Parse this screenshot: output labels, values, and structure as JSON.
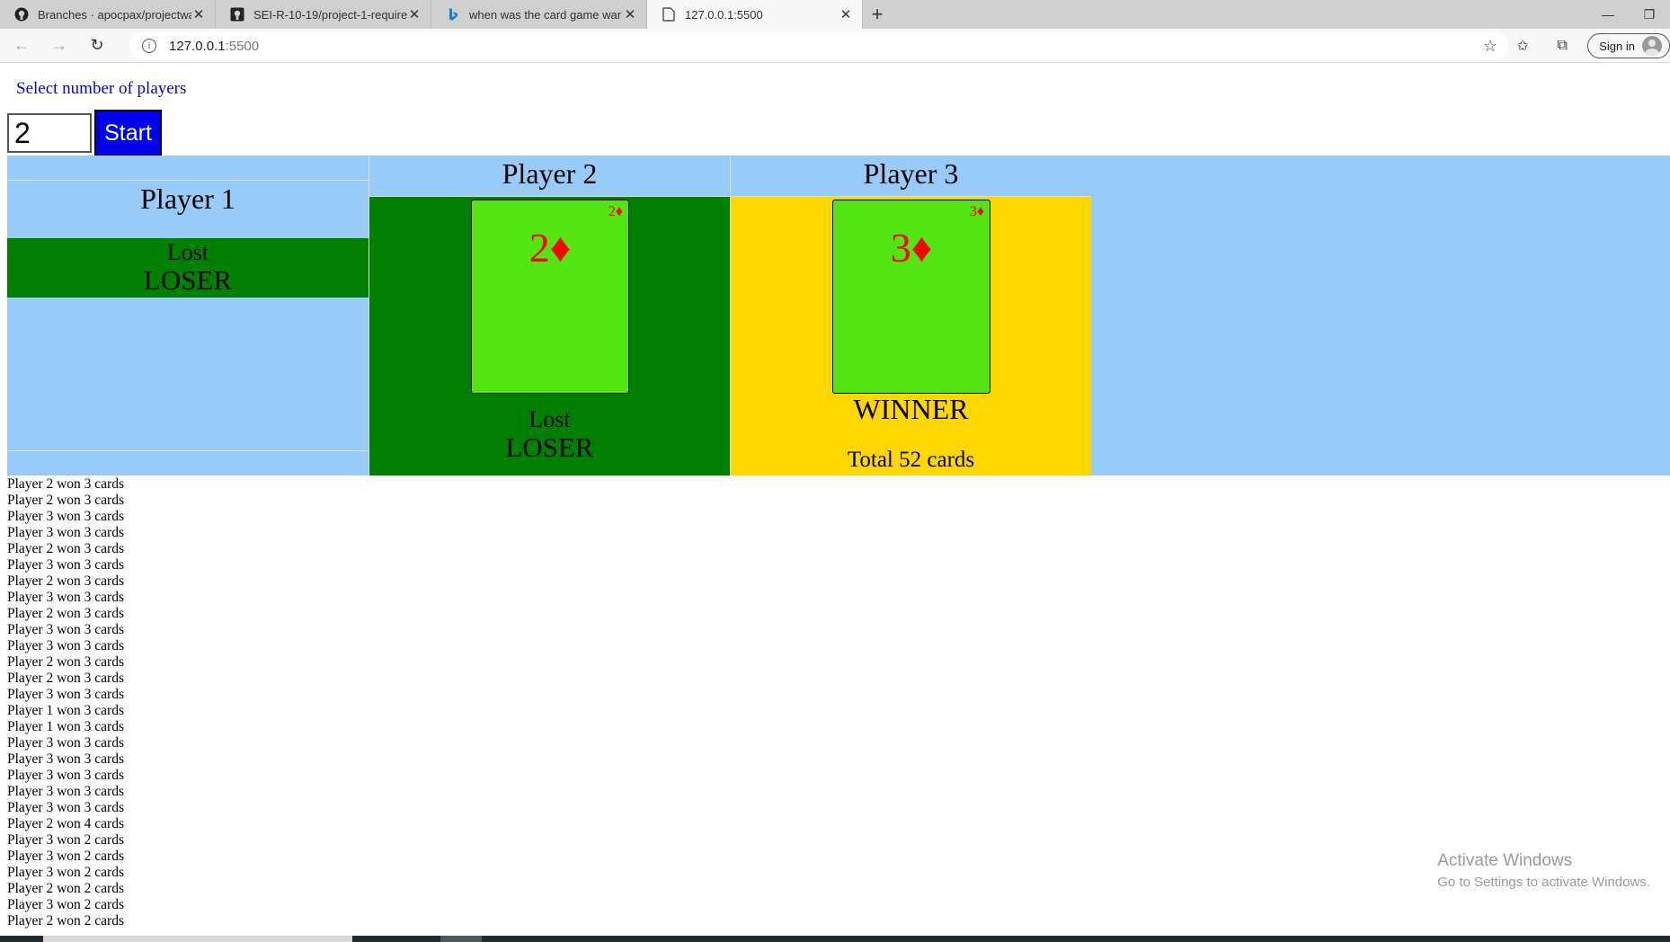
{
  "browser": {
    "tabs": [
      {
        "title": "Branches · apocpax/projectwar",
        "icon": "github-icon"
      },
      {
        "title": "SEI-R-10-19/project-1-requirements",
        "icon": "github-icon"
      },
      {
        "title": "when was the card game war invented",
        "icon": "bing-icon"
      },
      {
        "title": "127.0.0.1:5500",
        "icon": "page-icon",
        "active": true
      }
    ],
    "new_tab_label": "+",
    "address": {
      "host": "127.0.0.1",
      "port": ":5500"
    },
    "sign_in_label": "Sign in"
  },
  "controls": {
    "select_label": "Select number of players",
    "players_value": "2",
    "start_label": "Start"
  },
  "players": {
    "p1": {
      "name": "Player 1",
      "status_line1": "Lost",
      "status_line2": "LOSER"
    },
    "p2": {
      "name": "Player 2",
      "card_rank": "2♦",
      "status_line1": "Lost",
      "status_line2": "LOSER"
    },
    "p3": {
      "name": "Player 3",
      "card_rank": "3♦",
      "result": "WINNER",
      "total": "Total 52 cards"
    }
  },
  "log": [
    "Player 2 won 3 cards",
    "Player 2 won 3 cards",
    "Player 3 won 3 cards",
    "Player 3 won 3 cards",
    "Player 2 won 3 cards",
    "Player 3 won 3 cards",
    "Player 2 won 3 cards",
    "Player 3 won 3 cards",
    "Player 2 won 3 cards",
    "Player 3 won 3 cards",
    "Player 3 won 3 cards",
    "Player 2 won 3 cards",
    "Player 2 won 3 cards",
    "Player 3 won 3 cards",
    "Player 1 won 3 cards",
    "Player 1 won 3 cards",
    "Player 3 won 3 cards",
    "Player 3 won 3 cards",
    "Player 3 won 3 cards",
    "Player 3 won 3 cards",
    "Player 3 won 3 cards",
    "Player 2 won 4 cards",
    "Player 3 won 2 cards",
    "Player 3 won 2 cards",
    "Player 3 won 2 cards",
    "Player 2 won 2 cards",
    "Player 3 won 2 cards",
    "Player 2 won 2 cards"
  ],
  "watermark": {
    "line1": "Activate Windows",
    "line2": "Go to Settings to activate Windows."
  },
  "colors": {
    "board_bg": "#99cbf8",
    "loser_bg": "#008000",
    "winner_bg": "#ffd700",
    "card_bg": "#52e512",
    "suit_red": "#ff0000",
    "start_button": "#0000ee"
  }
}
